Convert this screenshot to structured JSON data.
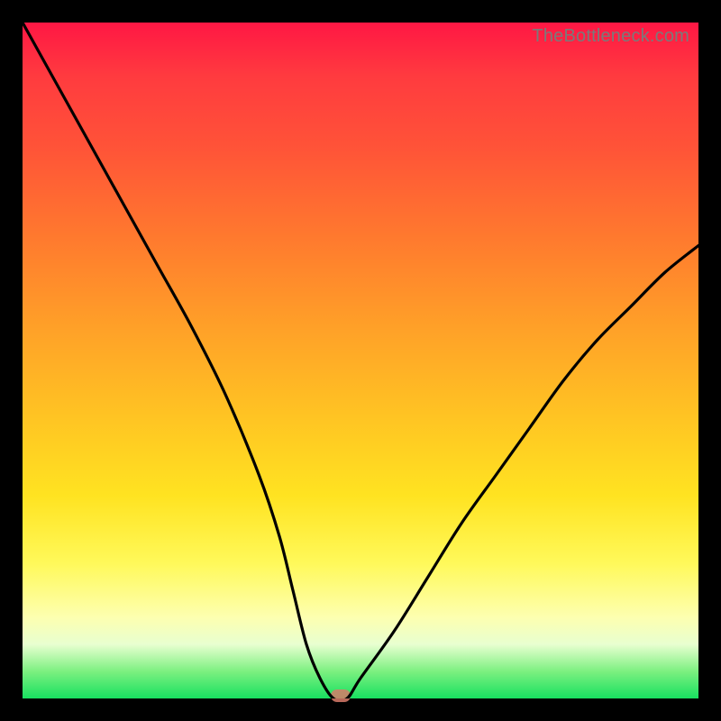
{
  "attribution": "TheBottleneck.com",
  "colors": {
    "frame": "#000000",
    "curve": "#000000",
    "marker": "#d87a6a",
    "gradient_stops": [
      "#ff1744",
      "#ff7a2e",
      "#ffe321",
      "#fdffb0",
      "#18e060"
    ]
  },
  "chart_data": {
    "type": "line",
    "title": "",
    "xlabel": "",
    "ylabel": "",
    "xlim": [
      0,
      100
    ],
    "ylim": [
      0,
      100
    ],
    "grid": false,
    "legend": false,
    "series": [
      {
        "name": "bottleneck-curve",
        "x": [
          0,
          5,
          10,
          15,
          20,
          25,
          30,
          35,
          38,
          40,
          42,
          44,
          46,
          48,
          50,
          55,
          60,
          65,
          70,
          75,
          80,
          85,
          90,
          95,
          100
        ],
        "values": [
          100,
          91,
          82,
          73,
          64,
          55,
          45,
          33,
          24,
          16,
          8,
          3,
          0,
          0,
          3,
          10,
          18,
          26,
          33,
          40,
          47,
          53,
          58,
          63,
          67
        ]
      }
    ],
    "annotations": [
      {
        "name": "optimal-point",
        "x": 47,
        "y": 0
      }
    ]
  }
}
